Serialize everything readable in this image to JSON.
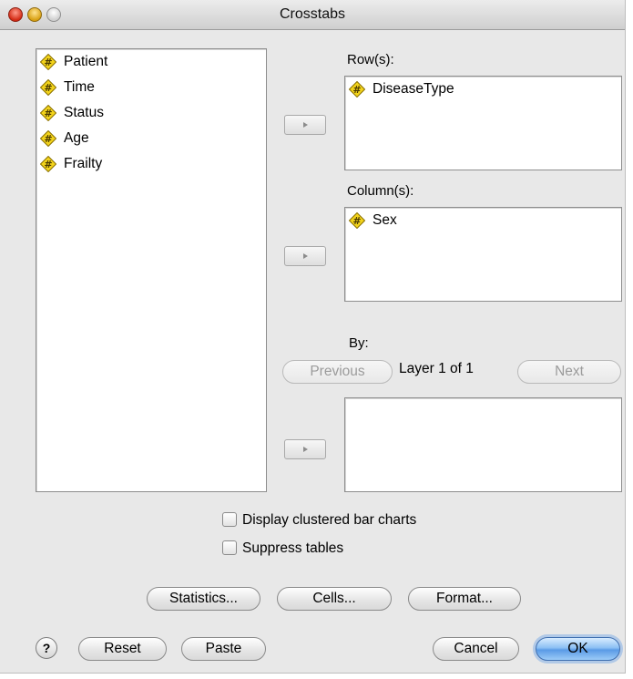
{
  "window": {
    "title": "Crosstabs"
  },
  "source_list": {
    "items": [
      {
        "label": "Patient",
        "icon": "numeric-variable-icon"
      },
      {
        "label": "Time",
        "icon": "numeric-variable-icon"
      },
      {
        "label": "Status",
        "icon": "numeric-variable-icon"
      },
      {
        "label": "Age",
        "icon": "numeric-variable-icon"
      },
      {
        "label": "Frailty",
        "icon": "numeric-variable-icon"
      }
    ]
  },
  "rows": {
    "label": "Row(s):",
    "items": [
      {
        "label": "DiseaseType",
        "icon": "numeric-variable-icon"
      }
    ]
  },
  "columns": {
    "label": "Column(s):",
    "items": [
      {
        "label": "Sex",
        "icon": "numeric-variable-icon"
      }
    ]
  },
  "layer": {
    "label": "By:",
    "previous_label": "Previous",
    "next_label": "Next",
    "status_text": "Layer 1 of 1",
    "items": []
  },
  "options": {
    "clustered_bar_charts": {
      "label": "Display clustered bar charts",
      "checked": false
    },
    "suppress_tables": {
      "label": "Suppress tables",
      "checked": false
    }
  },
  "buttons": {
    "statistics": "Statistics...",
    "cells": "Cells...",
    "format": "Format...",
    "help": "?",
    "reset": "Reset",
    "paste": "Paste",
    "cancel": "Cancel",
    "ok": "OK"
  },
  "colors": {
    "icon_fill": "#f2d31b",
    "icon_border": "#8a7000",
    "default_button": "#5a9ae6"
  }
}
